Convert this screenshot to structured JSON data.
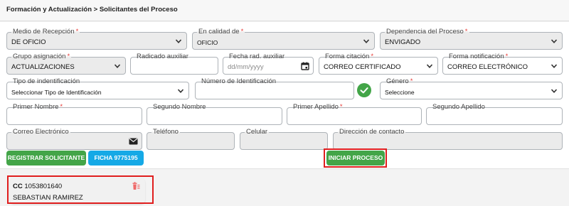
{
  "header": {
    "title": "Formación y Actualización > Solicitantes del Proceso"
  },
  "row1": {
    "medio": {
      "label": "Medio de Recepción",
      "value": "DE OFICIO"
    },
    "calidad": {
      "label": "En calidad de",
      "value": "OFICIO"
    },
    "dependencia": {
      "label": "Dependencia del Proceso",
      "value": "ENVIGADO"
    }
  },
  "row2": {
    "grupo": {
      "label": "Grupo asignación",
      "value": "ACTUALIZACIONES"
    },
    "radicado": {
      "label": "Radicado auxiliar",
      "value": ""
    },
    "fecha": {
      "label": "Fecha rad. auxiliar",
      "placeholder": "dd/mm/yyyy"
    },
    "citacion": {
      "label": "Forma citación",
      "value": "CORREO CERTIFICADO"
    },
    "notificacion": {
      "label": "Forma notificación",
      "value": "CORREO ELECTRÓNICO"
    }
  },
  "row3": {
    "tipo_id": {
      "label": "Tipo de indentificación",
      "value": "Seleccionar Tipo de Identificación"
    },
    "numero_id": {
      "label": "Número de Identificación",
      "value": ""
    },
    "genero": {
      "label": "Género",
      "value": "Seleccione"
    }
  },
  "row4": {
    "primer_nombre": {
      "label": "Primer Nombre"
    },
    "segundo_nombre": {
      "label": "Segundo Nombre"
    },
    "primer_apellido": {
      "label": "Primer Apellido"
    },
    "segundo_apellido": {
      "label": "Segundo Apellido"
    }
  },
  "row5": {
    "correo": {
      "label": "Correo Electrónico"
    },
    "telefono": {
      "label": "Teléfono"
    },
    "celular": {
      "label": "Celular"
    },
    "direccion": {
      "label": "Dirección de contacto"
    }
  },
  "buttons": {
    "registrar": "REGISTRAR SOLICITANTE",
    "ficha": "FICHA 9775195",
    "iniciar": "INICIAR PROCESO"
  },
  "requester": {
    "doc_type": "CC",
    "doc_number": "1053801640",
    "name": "SEBASTIAN RAMIREZ"
  },
  "colors": {
    "green": "#43a548",
    "blue": "#15a9e6",
    "highlight": "#e01e1e",
    "required": "#e53935"
  },
  "icons": [
    "chevron-down-icon",
    "calendar-icon",
    "check-circle-icon",
    "envelope-icon",
    "delete-icon"
  ]
}
